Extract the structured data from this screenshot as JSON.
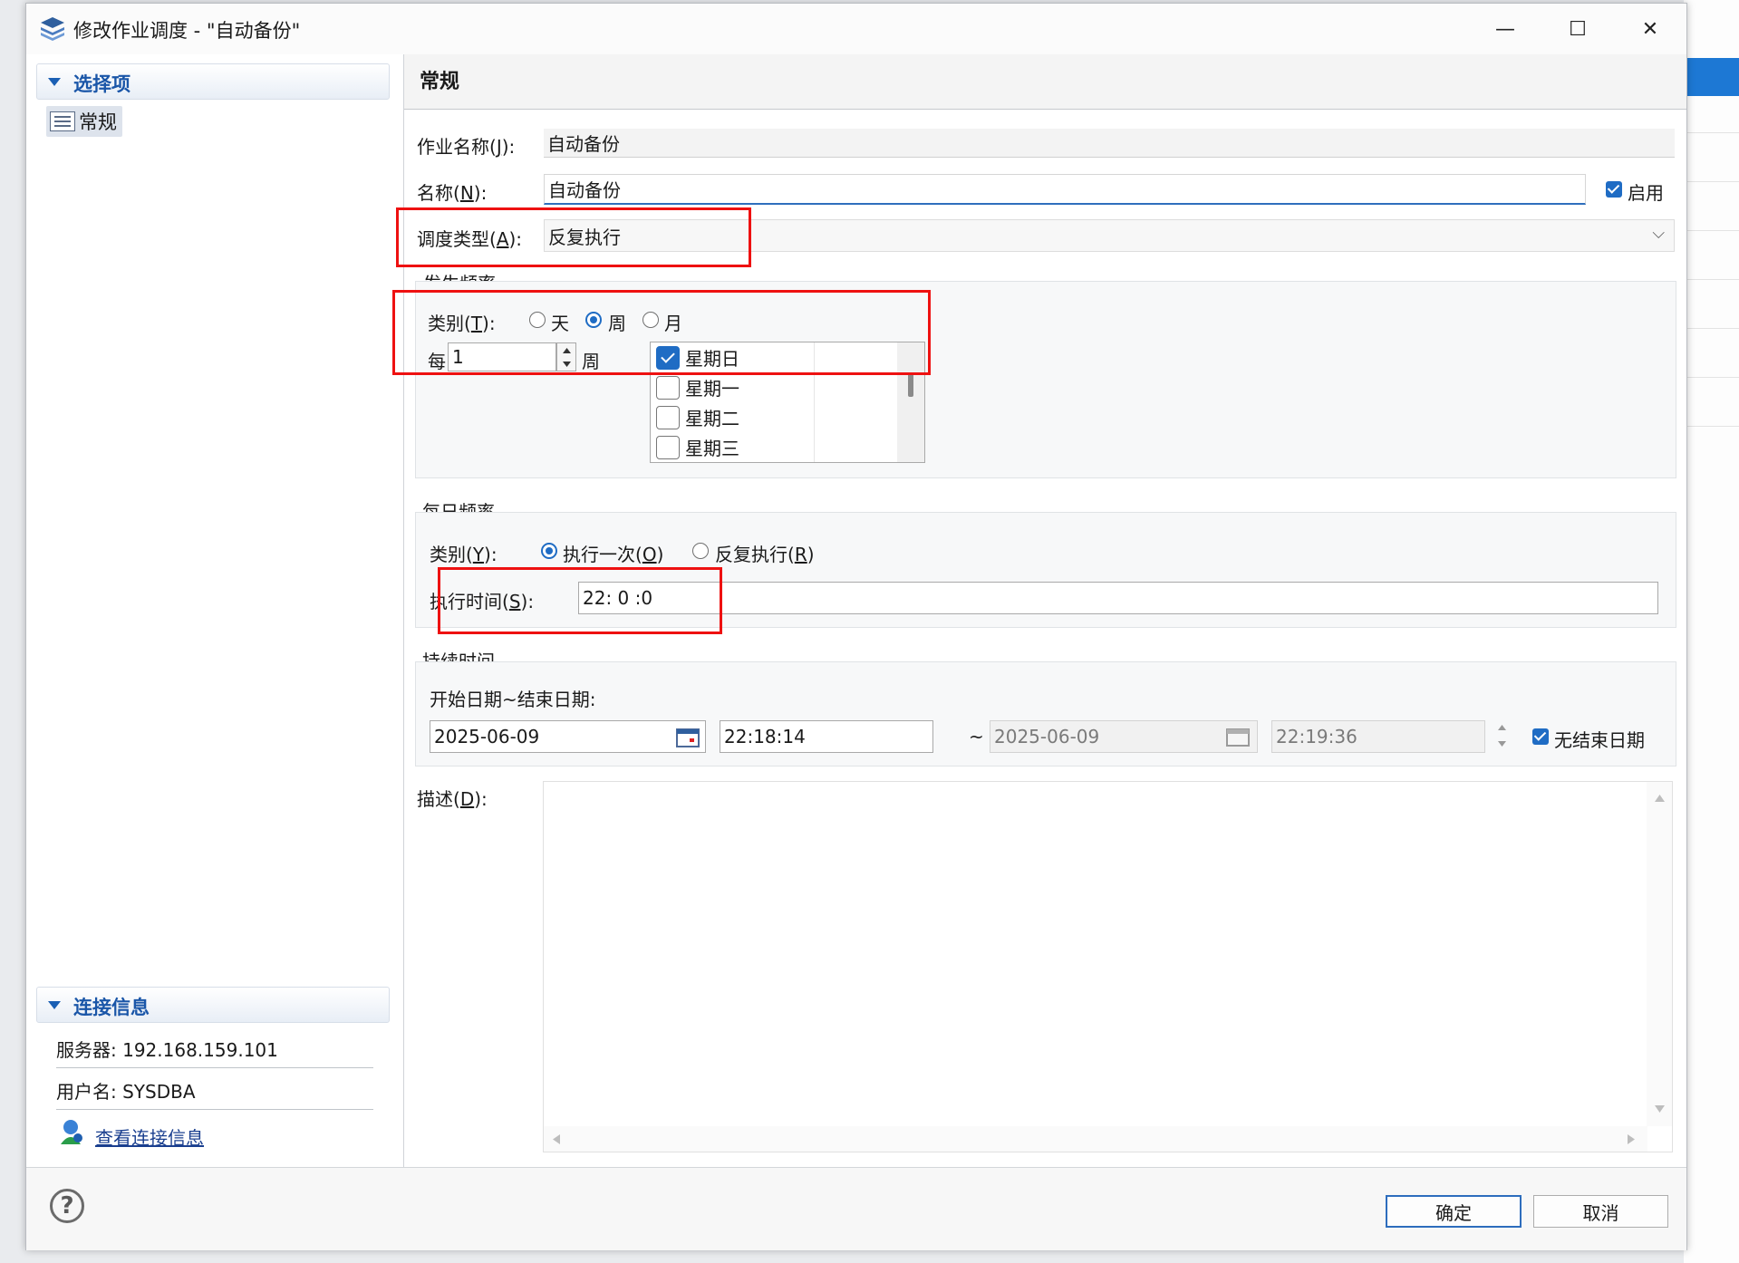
{
  "window": {
    "title": "修改作业调度 - \"自动备份\"",
    "minimize_glyph": "—",
    "maximize_glyph": "☐",
    "close_glyph": "✕"
  },
  "nav": {
    "section_title": "选择项",
    "items": [
      {
        "label": "常规",
        "icon": "list-icon"
      }
    ]
  },
  "connection": {
    "section_title": "连接信息",
    "server": "服务器: 192.168.159.101",
    "user": "用户名: SYSDBA",
    "view_link": "查看连接信息"
  },
  "general": {
    "header": "常规",
    "job_name": {
      "label": "作业名称(",
      "mnemonic": "J",
      "label_end": "):",
      "value": "自动备份"
    },
    "name": {
      "label": "名称(",
      "mnemonic": "N",
      "label_end": "):",
      "value": "自动备份"
    },
    "enabled": {
      "label": "启用",
      "checked": true
    },
    "schedule_type": {
      "label": "调度类型(",
      "mnemonic": "A",
      "label_end": "):",
      "value": "反复执行",
      "arrow_glyph": "⌵"
    }
  },
  "frequency": {
    "group_title": "发生频率",
    "category": {
      "label": "类别(",
      "mnemonic": "T",
      "label_end": "):",
      "options": [
        "天",
        "周",
        "月"
      ],
      "selected": "周"
    },
    "every": {
      "label": "每",
      "value": "1",
      "unit": "周"
    },
    "days": [
      {
        "label": "星期日",
        "checked": true
      },
      {
        "label": "星期一",
        "checked": false
      },
      {
        "label": "星期二",
        "checked": false
      },
      {
        "label": "星期三",
        "checked": false
      }
    ]
  },
  "daily": {
    "group_title": "每日频率",
    "category": {
      "label": "类别(",
      "mnemonic": "Y",
      "label_end": "):"
    },
    "once": {
      "label": "执行一次(",
      "mnemonic": "O",
      "label_end": ")",
      "selected": true
    },
    "repeat": {
      "label": "反复执行(",
      "mnemonic": "R",
      "label_end": ")",
      "selected": false
    },
    "exec_time": {
      "label": "执行时间(",
      "mnemonic": "S",
      "label_end": "):",
      "value": "22: 0 :0"
    }
  },
  "duration": {
    "group_title": "持续时间",
    "range_label": "开始日期~结束日期:",
    "start_date": "2025-06-09",
    "start_time": "22:18:14",
    "tilde": "~",
    "end_date": "2025-06-09",
    "end_time": "22:19:36",
    "no_end": {
      "label": "无结束日期",
      "checked": true
    }
  },
  "description": {
    "label": "描述(",
    "mnemonic": "D",
    "label_end": "):",
    "value": ""
  },
  "footer": {
    "help_glyph": "?",
    "ok": "确定",
    "cancel": "取消"
  },
  "colors": {
    "accent": "#1f6cc4",
    "highlight_box": "#ee1111",
    "section_title": "#1a56a8"
  }
}
